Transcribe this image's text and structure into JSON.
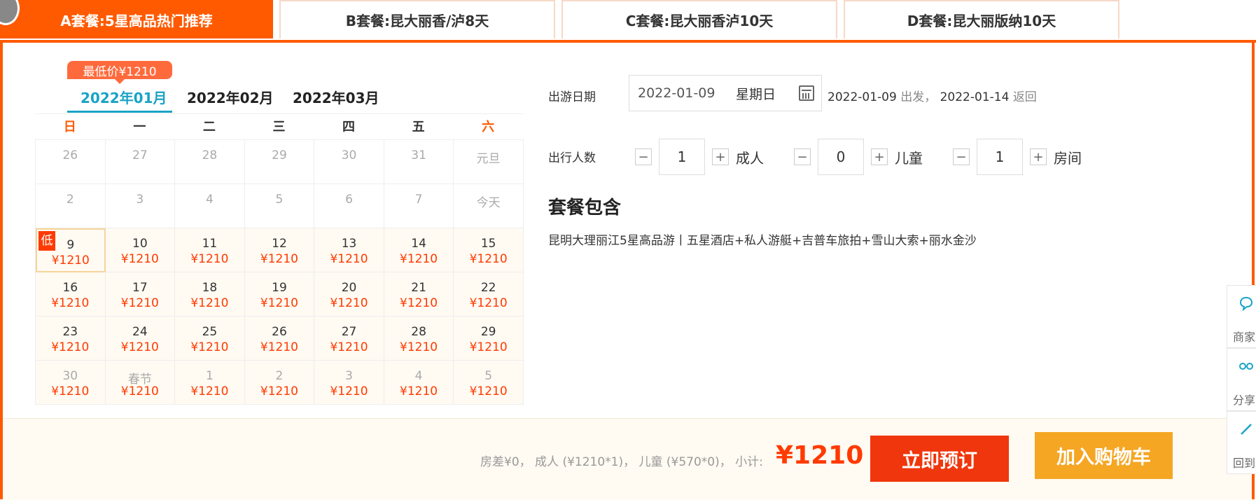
{
  "tabs": [
    {
      "label": "A套餐:5星高品热门推荐",
      "active": true
    },
    {
      "label": "B套餐:昆大丽香/泸8天",
      "active": false
    },
    {
      "label": "C套餐:昆大丽香泸10天",
      "active": false
    },
    {
      "label": "D套餐:昆大丽版纳10天",
      "active": false
    }
  ],
  "calendar": {
    "low_price_badge": "最低价¥1210",
    "months": [
      "2022年01月",
      "2022年02月",
      "2022年03月"
    ],
    "active_month": "2022年01月",
    "weekdays": [
      "日",
      "一",
      "二",
      "三",
      "四",
      "五",
      "六"
    ],
    "low_tag": "低",
    "rows": [
      [
        {
          "day": "26"
        },
        {
          "day": "27"
        },
        {
          "day": "28"
        },
        {
          "day": "29"
        },
        {
          "day": "30"
        },
        {
          "day": "31"
        },
        {
          "day": "元旦"
        }
      ],
      [
        {
          "day": "2"
        },
        {
          "day": "3"
        },
        {
          "day": "4"
        },
        {
          "day": "5"
        },
        {
          "day": "6"
        },
        {
          "day": "7"
        },
        {
          "day": "今天"
        }
      ],
      [
        {
          "day": "9",
          "price": "¥1210"
        },
        {
          "day": "10",
          "price": "¥1210"
        },
        {
          "day": "11",
          "price": "¥1210"
        },
        {
          "day": "12",
          "price": "¥1210"
        },
        {
          "day": "13",
          "price": "¥1210"
        },
        {
          "day": "14",
          "price": "¥1210"
        },
        {
          "day": "15",
          "price": "¥1210"
        }
      ],
      [
        {
          "day": "16",
          "price": "¥1210"
        },
        {
          "day": "17",
          "price": "¥1210"
        },
        {
          "day": "18",
          "price": "¥1210"
        },
        {
          "day": "19",
          "price": "¥1210"
        },
        {
          "day": "20",
          "price": "¥1210"
        },
        {
          "day": "21",
          "price": "¥1210"
        },
        {
          "day": "22",
          "price": "¥1210"
        }
      ],
      [
        {
          "day": "23",
          "price": "¥1210"
        },
        {
          "day": "24",
          "price": "¥1210"
        },
        {
          "day": "25",
          "price": "¥1210"
        },
        {
          "day": "26",
          "price": "¥1210"
        },
        {
          "day": "27",
          "price": "¥1210"
        },
        {
          "day": "28",
          "price": "¥1210"
        },
        {
          "day": "29",
          "price": "¥1210"
        }
      ],
      [
        {
          "day": "30",
          "price": "¥1210"
        },
        {
          "day": "春节",
          "price": "¥1210"
        },
        {
          "day": "1",
          "price": "¥1210"
        },
        {
          "day": "2",
          "price": "¥1210"
        },
        {
          "day": "3",
          "price": "¥1210"
        },
        {
          "day": "4",
          "price": "¥1210"
        },
        {
          "day": "5",
          "price": "¥1210"
        }
      ]
    ]
  },
  "form": {
    "date_label": "出游日期",
    "date_value": "2022-01-09",
    "weekday_value": "星期日",
    "depart_date": "2022-01-09",
    "depart_text": "出发，",
    "return_date": "2022-01-14",
    "return_text": "返回",
    "people_label": "出行人数",
    "adults": {
      "value": "1",
      "unit": "成人"
    },
    "children": {
      "value": "0",
      "unit": "儿童"
    },
    "rooms": {
      "value": "1",
      "unit": "房间"
    },
    "minus": "−",
    "plus": "+"
  },
  "package": {
    "title": "套餐包含",
    "description": "昆明大理丽江5星高品游丨五星酒店+私人游艇+吉普车旅拍+雪山大索+丽水金沙"
  },
  "footer": {
    "breakdown": "房差¥0， 成人 (¥1210*1)， 儿童 (¥570*0)， 小计:",
    "subtotal": "¥1210",
    "book_label": "立即预订",
    "cart_label": "加入购物车"
  },
  "side_tools": [
    {
      "label": "商家",
      "icon": "chat-icon"
    },
    {
      "label": "分享",
      "icon": "share-icon"
    },
    {
      "label": "回到",
      "icon": "back-to-top-icon"
    }
  ],
  "colors": {
    "accent": "#ff5a00",
    "price": "#ff3a00",
    "month_active": "#1aa3c6",
    "cart": "#f5a623"
  }
}
